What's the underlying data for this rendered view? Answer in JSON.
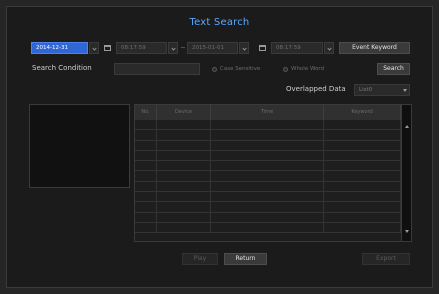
{
  "dialog": {
    "title": "Text Search"
  },
  "range": {
    "start_date": "2014-12-31",
    "start_time": "08:17:59",
    "separator": "~",
    "end_date": "2015-01-01",
    "end_time": "08:17:59"
  },
  "buttons": {
    "event_keyword": "Event Keyword",
    "search": "Search",
    "play": "Play",
    "return": "Return",
    "export": "Export"
  },
  "search": {
    "condition_label": "Search Condition",
    "condition_value": "",
    "case_sensitive": "Case Sensitive",
    "whole_word": "Whole Word"
  },
  "overlapped": {
    "label": "Overlapped Data",
    "value": "List0"
  },
  "results": {
    "columns": [
      "No.",
      "Device",
      "Time",
      "Keyword"
    ],
    "row_count": 11
  },
  "colors": {
    "accent": "#2f67d6",
    "title": "#5aa7ff"
  },
  "icons": {
    "calendar": "calendar-icon",
    "spin": "chevron-down-icon"
  }
}
